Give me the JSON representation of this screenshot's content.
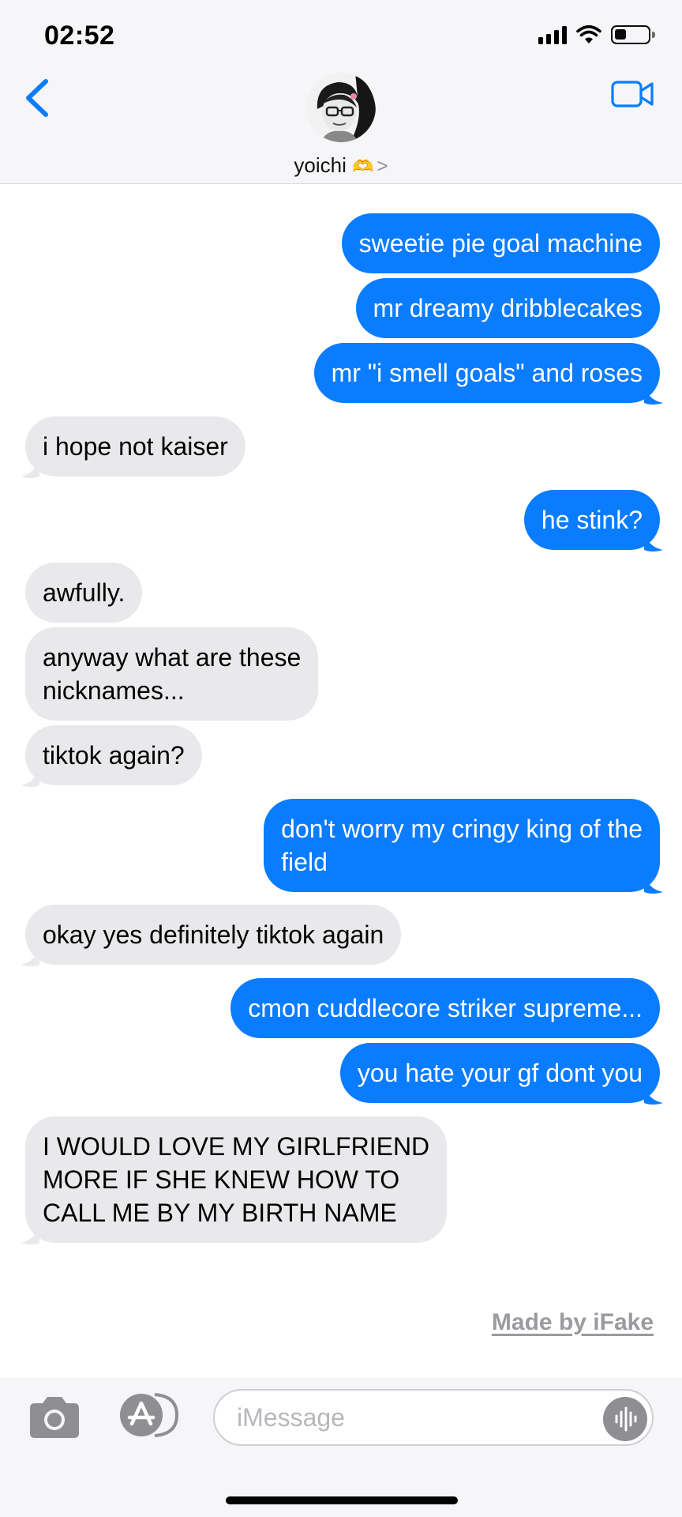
{
  "status_bar": {
    "time": "02:52"
  },
  "header": {
    "contact_name": "yoichi",
    "contact_emoji": "🫶",
    "chevron": ">"
  },
  "messages": [
    {
      "sender": "me",
      "text": "sweetie pie goal machine"
    },
    {
      "sender": "me",
      "text": "mr dreamy dribblecakes"
    },
    {
      "sender": "me",
      "text": "mr \"i smell goals\" and roses"
    },
    {
      "sender": "them",
      "text": "i hope not kaiser"
    },
    {
      "sender": "me",
      "text": "he stink?"
    },
    {
      "sender": "them",
      "text": "awfully."
    },
    {
      "sender": "them",
      "text": "anyway what are these\nnicknames..."
    },
    {
      "sender": "them",
      "text": "tiktok again?"
    },
    {
      "sender": "me",
      "text": "don't worry my cringy king of the\nfield"
    },
    {
      "sender": "them",
      "text": "okay yes definitely tiktok again"
    },
    {
      "sender": "me",
      "text": "cmon cuddlecore striker supreme..."
    },
    {
      "sender": "me",
      "text": "you hate your gf dont you"
    },
    {
      "sender": "them",
      "text": "I WOULD LOVE MY GIRLFRIEND\nMORE IF SHE KNEW HOW TO\nCALL ME BY MY BIRTH NAME"
    }
  ],
  "watermark": "Made by iFake",
  "input": {
    "placeholder": "iMessage"
  },
  "colors": {
    "sent_bubble": "#0a7cff",
    "received_bubble": "#e9e9eb",
    "accent": "#0a7cff"
  },
  "icons": [
    "back-chevron-icon",
    "video-camera-icon",
    "camera-icon",
    "app-store-icon",
    "audio-waveform-icon"
  ]
}
